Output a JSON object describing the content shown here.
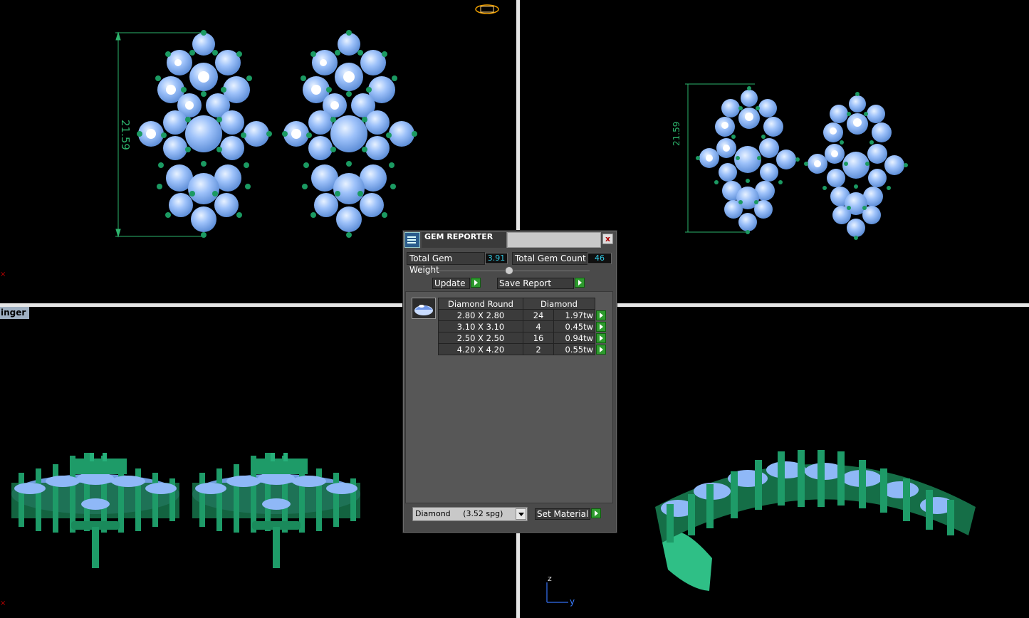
{
  "viewports": {
    "top_left": {
      "dimension_label": "21.59"
    },
    "top_right": {
      "dimension_label": "21.59"
    },
    "bottom_left": {
      "label": "inger"
    },
    "bottom_right": {
      "axis_z": "z",
      "axis_y": "y"
    }
  },
  "gem_reporter": {
    "title": "GEM REPORTER",
    "close_label": "x",
    "total_weight_label": "Total Gem Weight",
    "total_weight_value": "3.91",
    "total_count_label": "Total Gem Count",
    "total_count_value": "46",
    "update_label": "Update",
    "save_report_label": "Save Report",
    "table": {
      "headers": [
        "Diamond Round",
        "Diamond"
      ],
      "rows": [
        {
          "size": "2.80 X 2.80",
          "count": "24",
          "weight": "1.97tw"
        },
        {
          "size": "3.10 X 3.10",
          "count": "4",
          "weight": "0.45tw"
        },
        {
          "size": "2.50 X 2.50",
          "count": "16",
          "weight": "0.94tw"
        },
        {
          "size": "4.20 X 4.20",
          "count": "2",
          "weight": "0.55tw"
        }
      ]
    },
    "material_select": "Diamond     (3.52 spg)",
    "set_material_label": "Set Material"
  },
  "colors": {
    "gem": "#8fb8f7",
    "metal": "#1b9a62",
    "dimension": "#2db56d",
    "arrow_button": "#2e9a2e"
  }
}
